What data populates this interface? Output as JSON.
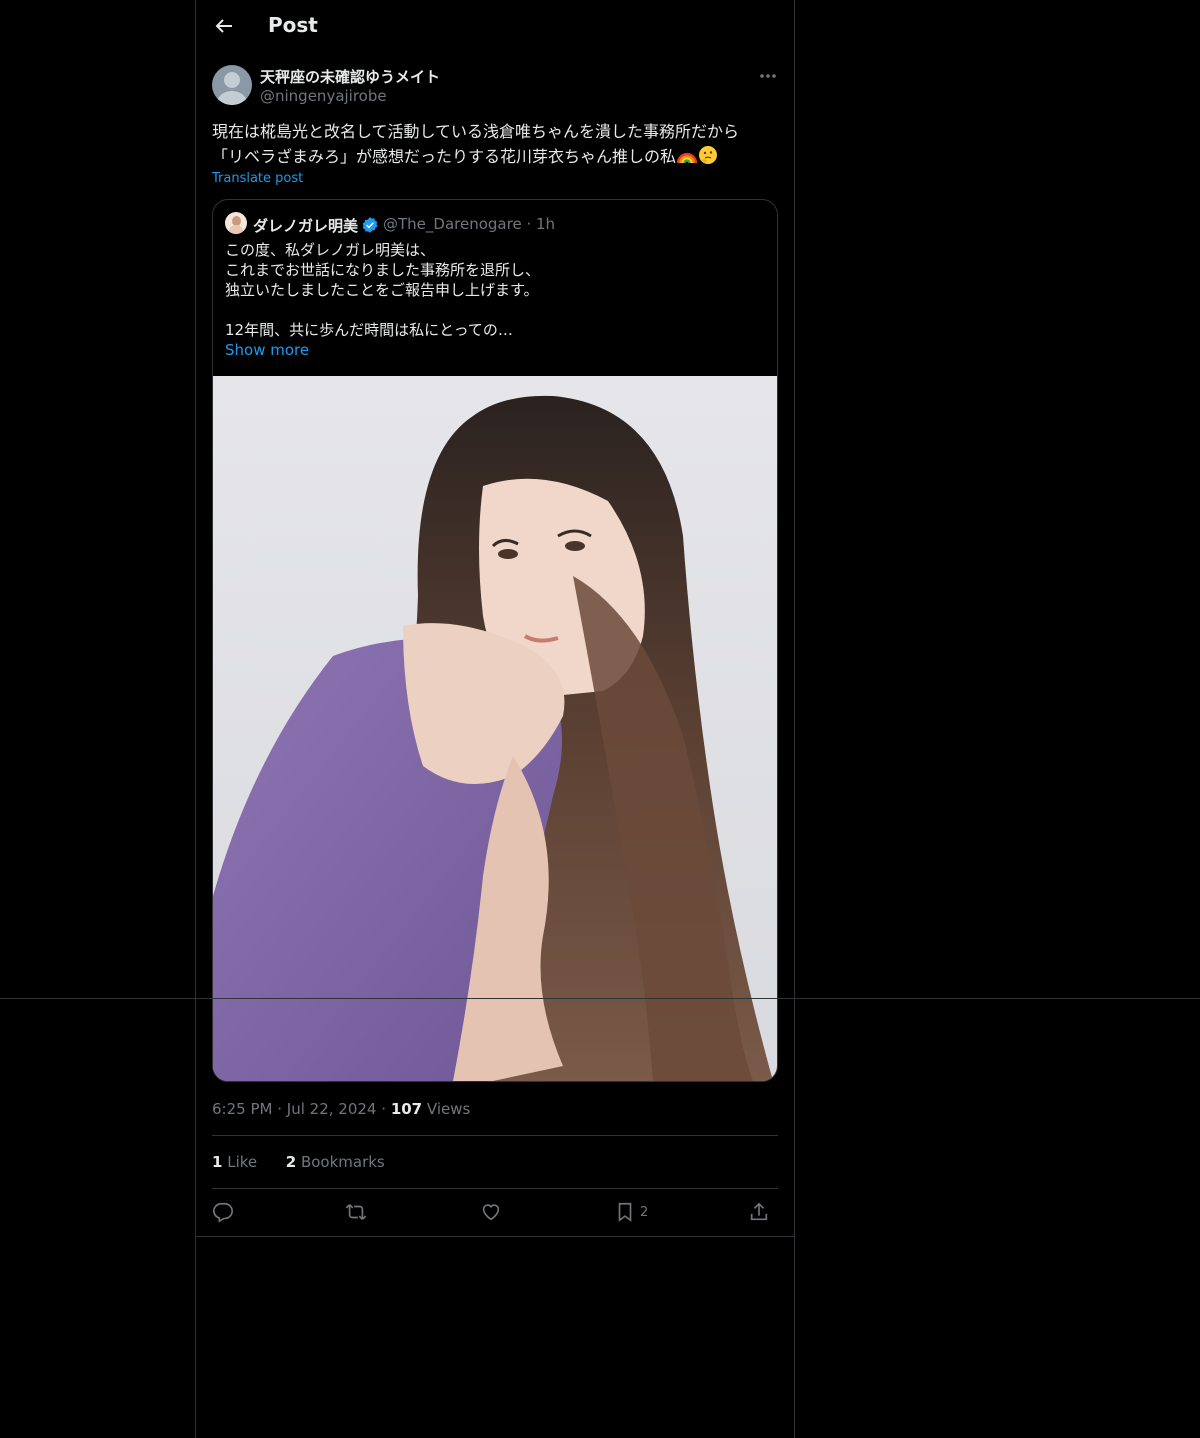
{
  "header": {
    "title": "Post",
    "back_icon": "arrow-left-icon"
  },
  "post": {
    "display_name": "天秤座の未確認ゆうメイト",
    "handle": "@ningenyajirobe",
    "text_line1": "現在は椛島光と改名して活動している浅倉唯ちゃんを潰した事務所だから",
    "text_line2": "「リベラざまみろ」が感想だったりする花川芽衣ちゃん推しの私",
    "emojis": [
      "rainbow-emoji",
      "thinking-face-emoji"
    ],
    "translate_label": "Translate post"
  },
  "quote": {
    "display_name": "ダレノガレ明美",
    "handle_time": "@The_Darenogare · 1h",
    "text": "この度、私ダレノガレ明美は、\nこれまでお世話になりました事務所を退所し、\n独立いたしましたことをご報告申し上げます。\n\n12年間、共に歩んだ時間は私にとっての…",
    "show_more": "Show more"
  },
  "meta": {
    "time": "6:25 PM",
    "dot1": "·",
    "date": "Jul 22, 2024",
    "dot2": "·",
    "views_count": "107",
    "views_label": " Views"
  },
  "stats": {
    "likes_count": "1",
    "likes_label": " Like",
    "bookmarks_count": "2",
    "bookmarks_label": " Bookmarks"
  },
  "actions": {
    "reply_icon": "reply-icon",
    "repost_icon": "repost-icon",
    "like_icon": "heart-icon",
    "bookmark_icon": "bookmark-icon",
    "bookmark_count": "2",
    "share_icon": "share-icon"
  },
  "colors": {
    "background": "#000000",
    "text": "#e7e9ea",
    "muted": "#71767b",
    "accent": "#1d9bf0",
    "border": "#2f3336"
  }
}
